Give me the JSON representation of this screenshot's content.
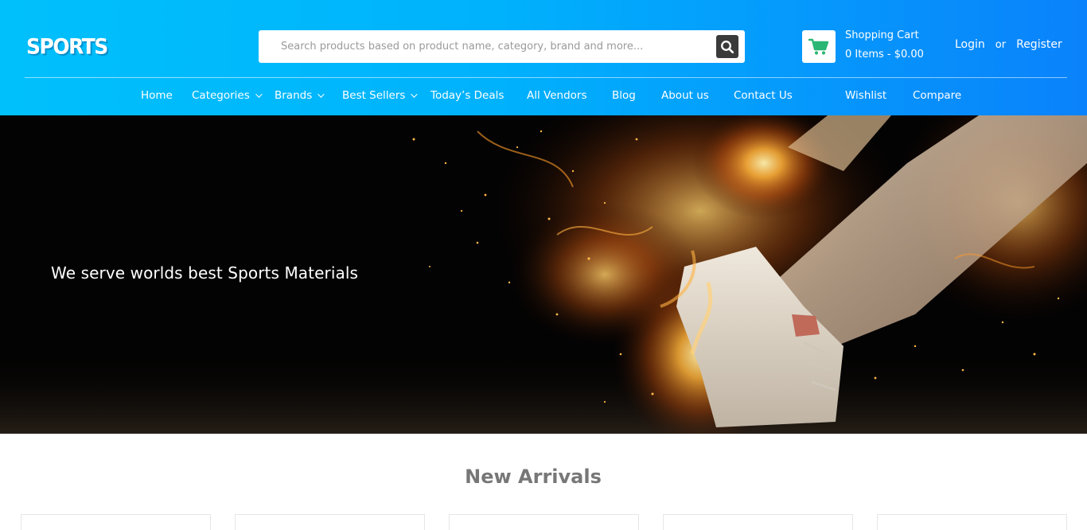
{
  "header": {
    "logo": "SPORTS",
    "search": {
      "placeholder": "Search products based on product name, category, brand and more..."
    },
    "cart": {
      "title": "Shopping Cart",
      "summary": "0 Items - $0.00"
    },
    "auth": {
      "login": "Login",
      "or": "or",
      "register": "Register"
    }
  },
  "nav": {
    "items": [
      {
        "label": "Home"
      },
      {
        "label": "Categories"
      },
      {
        "label": "Brands"
      },
      {
        "label": "Best Sellers"
      },
      {
        "label": "Today’s Deals"
      },
      {
        "label": "All Vendors"
      },
      {
        "label": "Blog"
      },
      {
        "label": "About us"
      },
      {
        "label": "Contact Us"
      },
      {
        "label": "Wishlist"
      },
      {
        "label": "Compare"
      }
    ]
  },
  "hero": {
    "tagline": "We serve worlds best Sports Materials"
  },
  "new_arrivals": {
    "title": "New Arrivals"
  },
  "colors": {
    "header_start": "#00c0fb",
    "header_end": "#0a82fb",
    "cart_icon": "#2bb673"
  },
  "icons": {
    "search": "magnifier-icon",
    "cart": "cart-icon",
    "dropdown": "chevron-down-icon"
  }
}
